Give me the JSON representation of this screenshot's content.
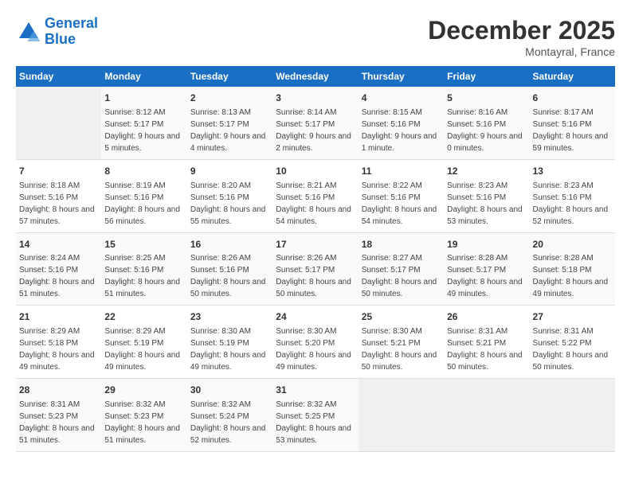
{
  "logo": {
    "line1": "General",
    "line2": "Blue"
  },
  "title": "December 2025",
  "subtitle": "Montayral, France",
  "days_of_week": [
    "Sunday",
    "Monday",
    "Tuesday",
    "Wednesday",
    "Thursday",
    "Friday",
    "Saturday"
  ],
  "weeks": [
    [
      {
        "day": "",
        "sunrise": "",
        "sunset": "",
        "daylight": ""
      },
      {
        "day": "1",
        "sunrise": "Sunrise: 8:12 AM",
        "sunset": "Sunset: 5:17 PM",
        "daylight": "Daylight: 9 hours and 5 minutes."
      },
      {
        "day": "2",
        "sunrise": "Sunrise: 8:13 AM",
        "sunset": "Sunset: 5:17 PM",
        "daylight": "Daylight: 9 hours and 4 minutes."
      },
      {
        "day": "3",
        "sunrise": "Sunrise: 8:14 AM",
        "sunset": "Sunset: 5:17 PM",
        "daylight": "Daylight: 9 hours and 2 minutes."
      },
      {
        "day": "4",
        "sunrise": "Sunrise: 8:15 AM",
        "sunset": "Sunset: 5:16 PM",
        "daylight": "Daylight: 9 hours and 1 minute."
      },
      {
        "day": "5",
        "sunrise": "Sunrise: 8:16 AM",
        "sunset": "Sunset: 5:16 PM",
        "daylight": "Daylight: 9 hours and 0 minutes."
      },
      {
        "day": "6",
        "sunrise": "Sunrise: 8:17 AM",
        "sunset": "Sunset: 5:16 PM",
        "daylight": "Daylight: 8 hours and 59 minutes."
      }
    ],
    [
      {
        "day": "7",
        "sunrise": "Sunrise: 8:18 AM",
        "sunset": "Sunset: 5:16 PM",
        "daylight": "Daylight: 8 hours and 57 minutes."
      },
      {
        "day": "8",
        "sunrise": "Sunrise: 8:19 AM",
        "sunset": "Sunset: 5:16 PM",
        "daylight": "Daylight: 8 hours and 56 minutes."
      },
      {
        "day": "9",
        "sunrise": "Sunrise: 8:20 AM",
        "sunset": "Sunset: 5:16 PM",
        "daylight": "Daylight: 8 hours and 55 minutes."
      },
      {
        "day": "10",
        "sunrise": "Sunrise: 8:21 AM",
        "sunset": "Sunset: 5:16 PM",
        "daylight": "Daylight: 8 hours and 54 minutes."
      },
      {
        "day": "11",
        "sunrise": "Sunrise: 8:22 AM",
        "sunset": "Sunset: 5:16 PM",
        "daylight": "Daylight: 8 hours and 54 minutes."
      },
      {
        "day": "12",
        "sunrise": "Sunrise: 8:23 AM",
        "sunset": "Sunset: 5:16 PM",
        "daylight": "Daylight: 8 hours and 53 minutes."
      },
      {
        "day": "13",
        "sunrise": "Sunrise: 8:23 AM",
        "sunset": "Sunset: 5:16 PM",
        "daylight": "Daylight: 8 hours and 52 minutes."
      }
    ],
    [
      {
        "day": "14",
        "sunrise": "Sunrise: 8:24 AM",
        "sunset": "Sunset: 5:16 PM",
        "daylight": "Daylight: 8 hours and 51 minutes."
      },
      {
        "day": "15",
        "sunrise": "Sunrise: 8:25 AM",
        "sunset": "Sunset: 5:16 PM",
        "daylight": "Daylight: 8 hours and 51 minutes."
      },
      {
        "day": "16",
        "sunrise": "Sunrise: 8:26 AM",
        "sunset": "Sunset: 5:16 PM",
        "daylight": "Daylight: 8 hours and 50 minutes."
      },
      {
        "day": "17",
        "sunrise": "Sunrise: 8:26 AM",
        "sunset": "Sunset: 5:17 PM",
        "daylight": "Daylight: 8 hours and 50 minutes."
      },
      {
        "day": "18",
        "sunrise": "Sunrise: 8:27 AM",
        "sunset": "Sunset: 5:17 PM",
        "daylight": "Daylight: 8 hours and 50 minutes."
      },
      {
        "day": "19",
        "sunrise": "Sunrise: 8:28 AM",
        "sunset": "Sunset: 5:17 PM",
        "daylight": "Daylight: 8 hours and 49 minutes."
      },
      {
        "day": "20",
        "sunrise": "Sunrise: 8:28 AM",
        "sunset": "Sunset: 5:18 PM",
        "daylight": "Daylight: 8 hours and 49 minutes."
      }
    ],
    [
      {
        "day": "21",
        "sunrise": "Sunrise: 8:29 AM",
        "sunset": "Sunset: 5:18 PM",
        "daylight": "Daylight: 8 hours and 49 minutes."
      },
      {
        "day": "22",
        "sunrise": "Sunrise: 8:29 AM",
        "sunset": "Sunset: 5:19 PM",
        "daylight": "Daylight: 8 hours and 49 minutes."
      },
      {
        "day": "23",
        "sunrise": "Sunrise: 8:30 AM",
        "sunset": "Sunset: 5:19 PM",
        "daylight": "Daylight: 8 hours and 49 minutes."
      },
      {
        "day": "24",
        "sunrise": "Sunrise: 8:30 AM",
        "sunset": "Sunset: 5:20 PM",
        "daylight": "Daylight: 8 hours and 49 minutes."
      },
      {
        "day": "25",
        "sunrise": "Sunrise: 8:30 AM",
        "sunset": "Sunset: 5:21 PM",
        "daylight": "Daylight: 8 hours and 50 minutes."
      },
      {
        "day": "26",
        "sunrise": "Sunrise: 8:31 AM",
        "sunset": "Sunset: 5:21 PM",
        "daylight": "Daylight: 8 hours and 50 minutes."
      },
      {
        "day": "27",
        "sunrise": "Sunrise: 8:31 AM",
        "sunset": "Sunset: 5:22 PM",
        "daylight": "Daylight: 8 hours and 50 minutes."
      }
    ],
    [
      {
        "day": "28",
        "sunrise": "Sunrise: 8:31 AM",
        "sunset": "Sunset: 5:23 PM",
        "daylight": "Daylight: 8 hours and 51 minutes."
      },
      {
        "day": "29",
        "sunrise": "Sunrise: 8:32 AM",
        "sunset": "Sunset: 5:23 PM",
        "daylight": "Daylight: 8 hours and 51 minutes."
      },
      {
        "day": "30",
        "sunrise": "Sunrise: 8:32 AM",
        "sunset": "Sunset: 5:24 PM",
        "daylight": "Daylight: 8 hours and 52 minutes."
      },
      {
        "day": "31",
        "sunrise": "Sunrise: 8:32 AM",
        "sunset": "Sunset: 5:25 PM",
        "daylight": "Daylight: 8 hours and 53 minutes."
      },
      {
        "day": "",
        "sunrise": "",
        "sunset": "",
        "daylight": ""
      },
      {
        "day": "",
        "sunrise": "",
        "sunset": "",
        "daylight": ""
      },
      {
        "day": "",
        "sunrise": "",
        "sunset": "",
        "daylight": ""
      }
    ]
  ]
}
